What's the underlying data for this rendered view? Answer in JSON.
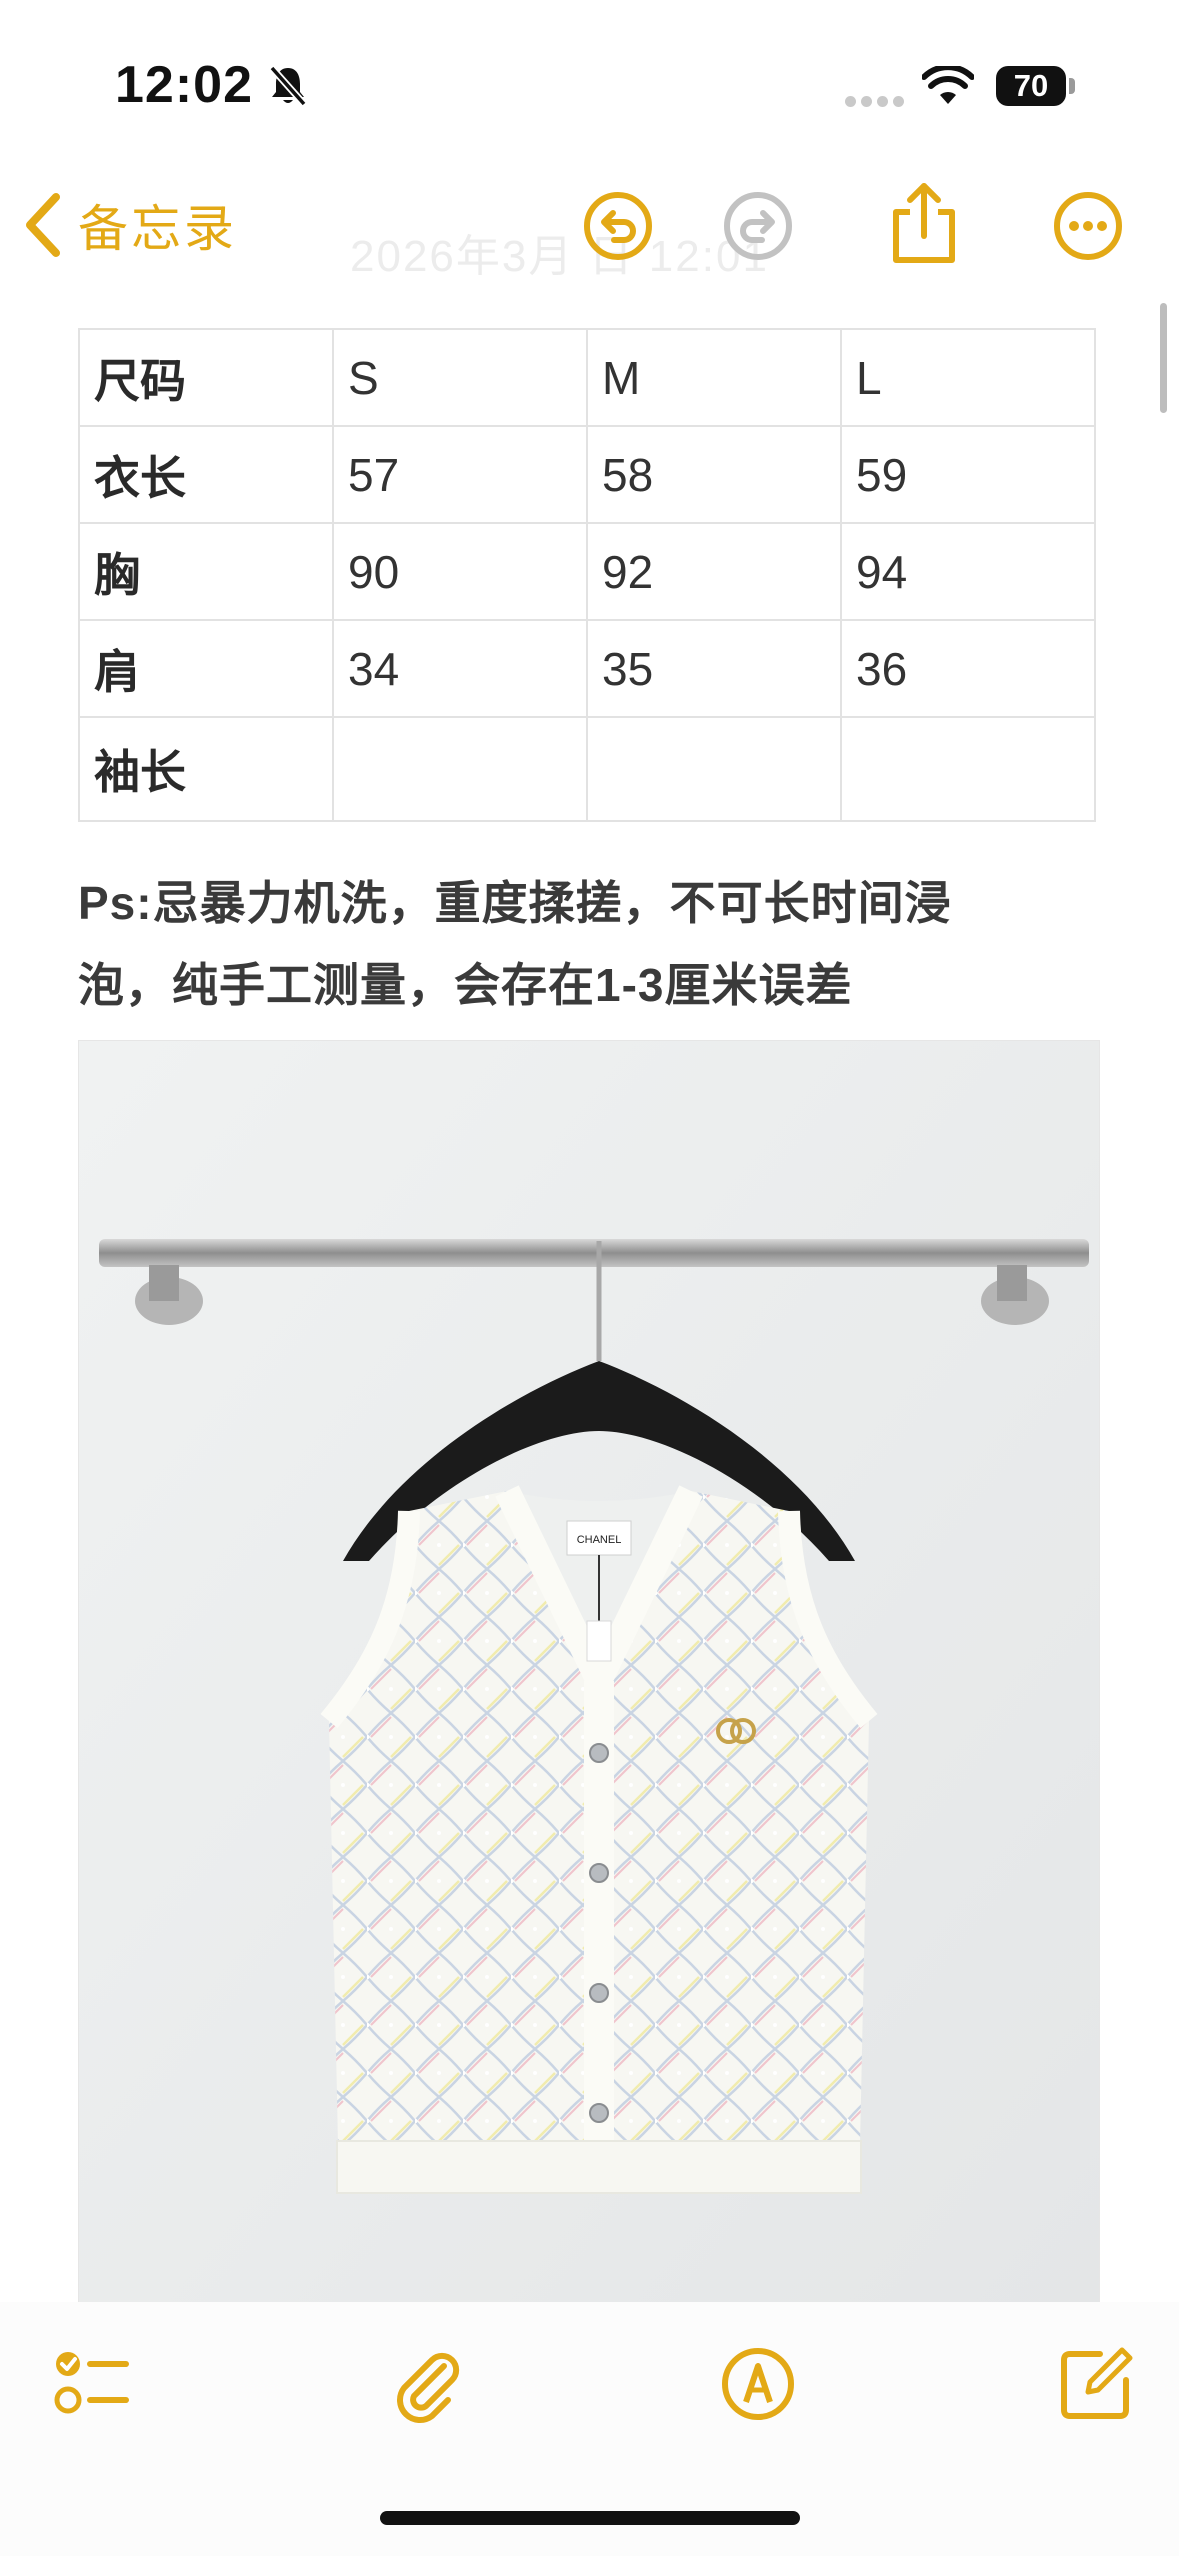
{
  "status_bar": {
    "time": "12:02",
    "battery": "70",
    "icons": [
      "bell-slash-icon",
      "cellular-signal-icon",
      "wifi-icon",
      "battery-icon"
    ]
  },
  "nav": {
    "back_label": "备忘录",
    "faded_title": "2026年3月 日 12:01",
    "accent_color": "#E3A916",
    "icons": [
      "undo-icon",
      "redo-icon",
      "share-icon",
      "more-icon"
    ]
  },
  "size_table": {
    "rows": [
      [
        "尺码",
        "S",
        "M",
        "L"
      ],
      [
        "衣长",
        "57",
        "58",
        "59"
      ],
      [
        "胸",
        "90",
        "92",
        "94"
      ],
      [
        "肩",
        "34",
        "35",
        "36"
      ],
      [
        "袖长",
        "",
        "",
        ""
      ]
    ]
  },
  "note": {
    "line1": "Ps:忌暴力机洗，重度揉搓，不可长时间浸",
    "line2": "泡，纯手工测量，会存在1-3厘米误差"
  },
  "photo": {
    "label_text": "CHANEL",
    "subject": "white sleeveless knit vest on hanger"
  },
  "toolbar": {
    "icons": [
      "checklist-icon",
      "paperclip-icon",
      "markup-pen-icon",
      "compose-icon"
    ]
  }
}
